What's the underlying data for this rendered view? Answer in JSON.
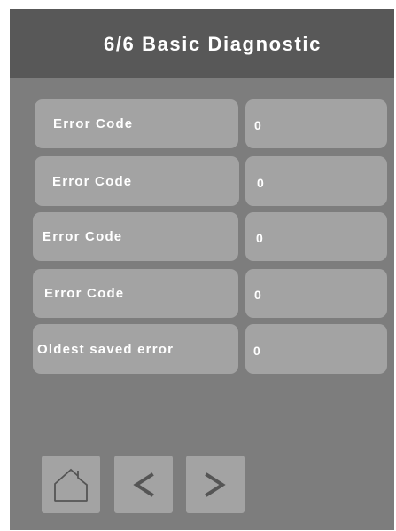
{
  "header": {
    "title": "6/6 Basic Diagnostic"
  },
  "rows": [
    {
      "label": "Error Code",
      "value": "0"
    },
    {
      "label": "Error Code",
      "value": "0"
    },
    {
      "label": "Error Code",
      "value": "0"
    },
    {
      "label": "Error Code",
      "value": "0"
    },
    {
      "label": "Oldest saved error",
      "value": "0"
    }
  ],
  "nav": {
    "home_icon": "home-icon",
    "prev_icon": "chevron-left-icon",
    "next_icon": "chevron-right-icon"
  },
  "colors": {
    "background": "#7d7d7d",
    "header": "#585858",
    "cell": "#a3a3a3",
    "text": "#ffffff",
    "icon": "#555555"
  }
}
